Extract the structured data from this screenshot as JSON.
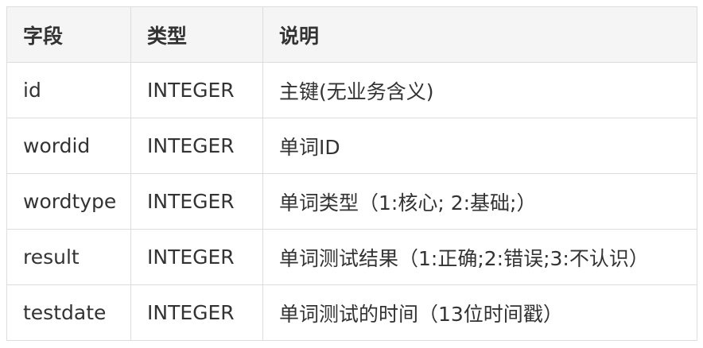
{
  "table": {
    "headers": [
      "字段",
      "类型",
      "说明"
    ],
    "rows": [
      [
        "id",
        "INTEGER",
        "主键(无业务含义)"
      ],
      [
        "wordid",
        "INTEGER",
        "单词ID"
      ],
      [
        "wordtype",
        "INTEGER",
        "单词类型（1:核心; 2:基础;）"
      ],
      [
        "result",
        "INTEGER",
        "单词测试结果（1:正确;2:错误;3:不认识）"
      ],
      [
        "testdate",
        "INTEGER",
        "单词测试的时间（13位时间戳）"
      ]
    ]
  },
  "colors": {
    "header_bg": "#f5f5f5",
    "border": "#dddddd",
    "text": "#333333"
  }
}
